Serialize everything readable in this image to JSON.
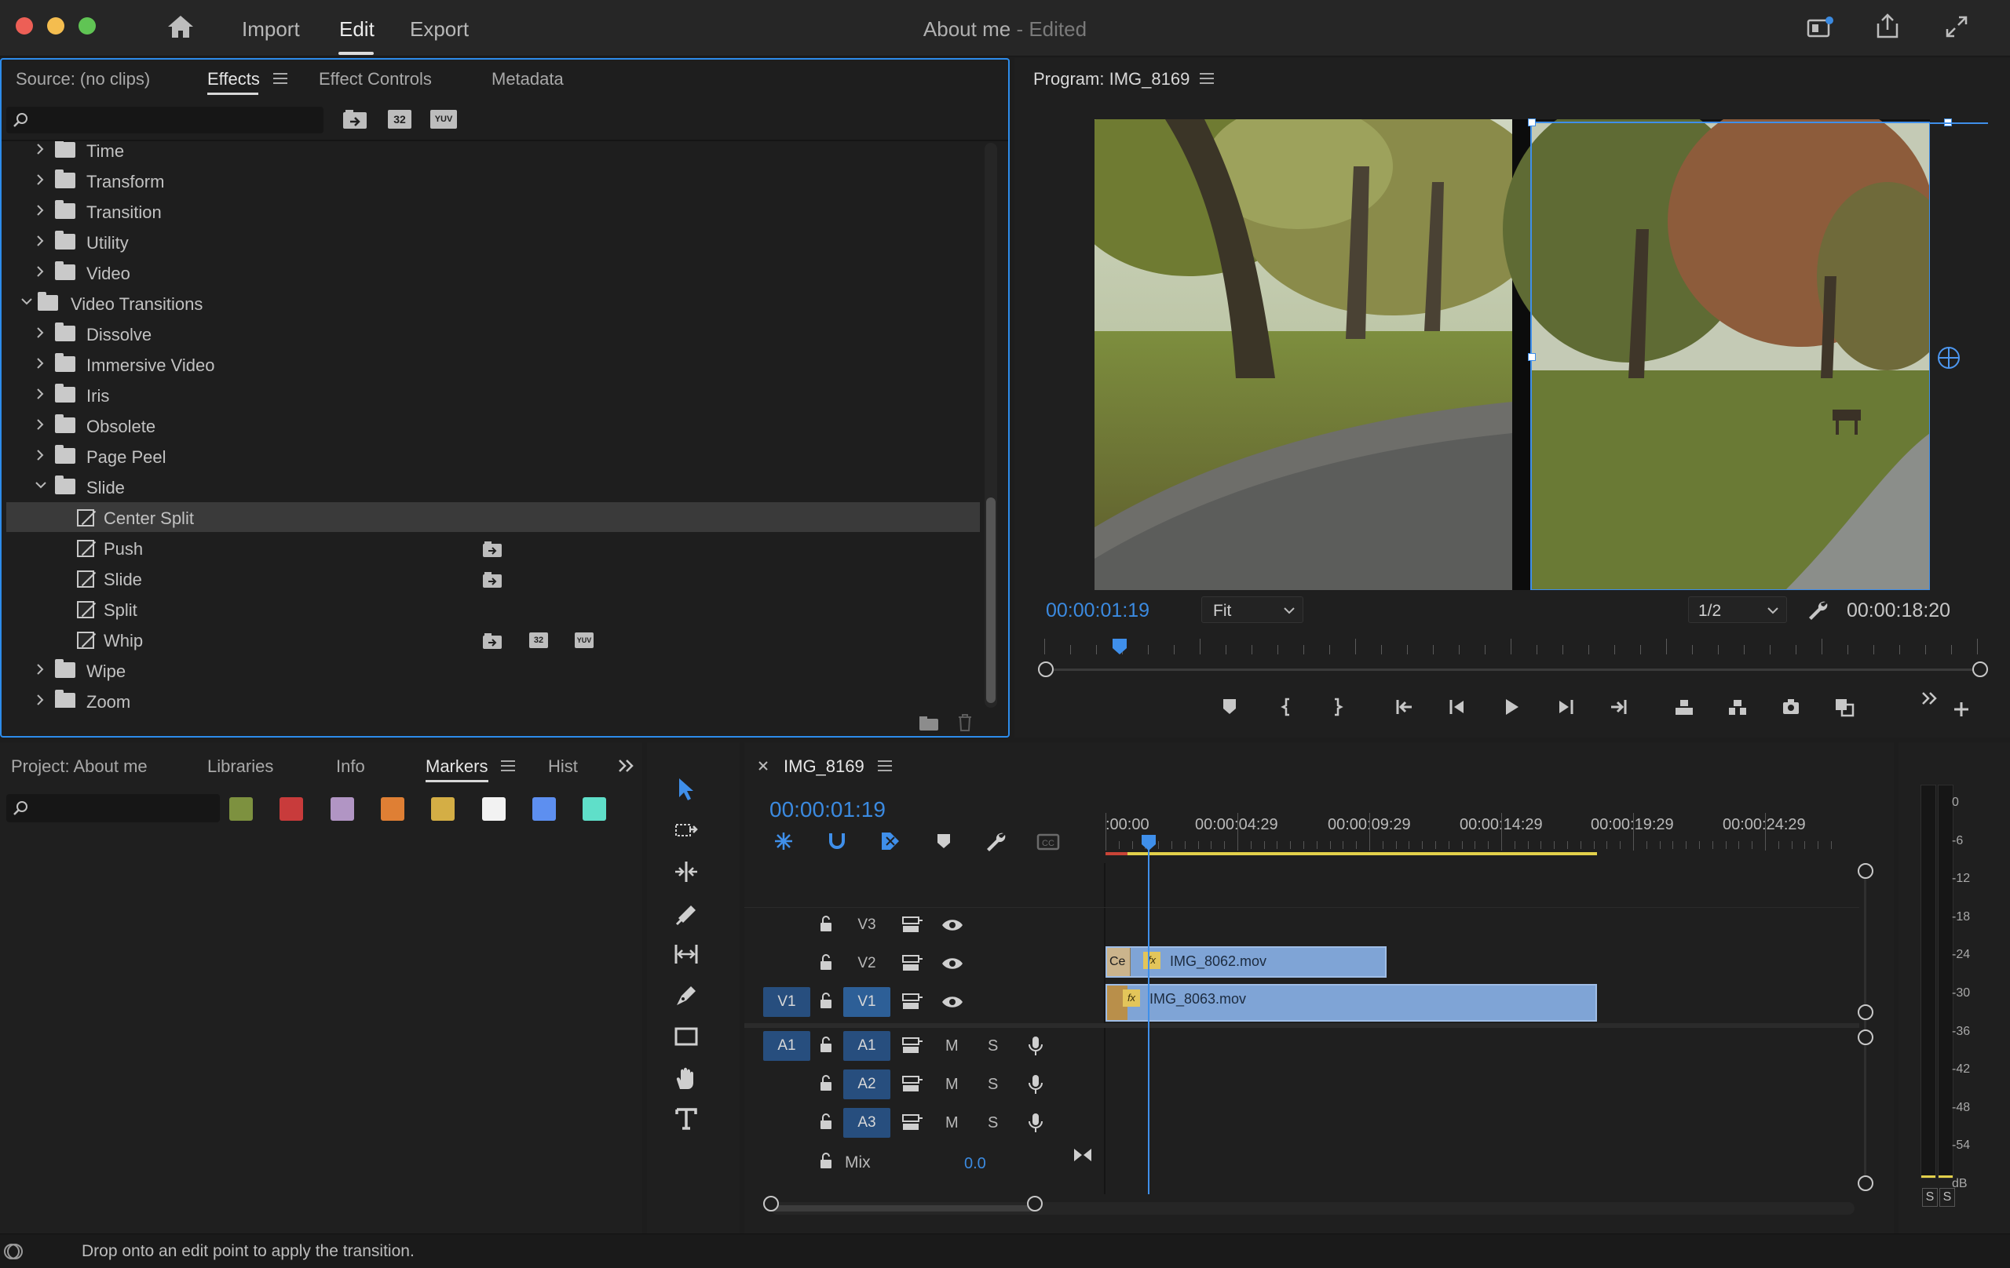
{
  "titlebar": {
    "nav": {
      "import": "Import",
      "edit": "Edit",
      "export": "Export"
    },
    "doc_title": "About me",
    "doc_status": "- Edited"
  },
  "source_panel": {
    "tabs": [
      "Source: (no clips)",
      "Effects",
      "Effect Controls",
      "Metadata"
    ],
    "active_tab": "Effects",
    "search_placeholder": "",
    "filter_badges": [
      "32",
      "YUV"
    ],
    "tree": [
      {
        "label": "Time",
        "kind": "folder",
        "level": 1,
        "expanded": false
      },
      {
        "label": "Transform",
        "kind": "folder",
        "level": 1,
        "expanded": false
      },
      {
        "label": "Transition",
        "kind": "folder",
        "level": 1,
        "expanded": false
      },
      {
        "label": "Utility",
        "kind": "folder",
        "level": 1,
        "expanded": false
      },
      {
        "label": "Video",
        "kind": "folder",
        "level": 1,
        "expanded": false
      },
      {
        "label": "Video Transitions",
        "kind": "folder",
        "level": 0,
        "expanded": true
      },
      {
        "label": "Dissolve",
        "kind": "folder",
        "level": 1,
        "expanded": false
      },
      {
        "label": "Immersive Video",
        "kind": "folder",
        "level": 1,
        "expanded": false
      },
      {
        "label": "Iris",
        "kind": "folder",
        "level": 1,
        "expanded": false
      },
      {
        "label": "Obsolete",
        "kind": "folder",
        "level": 1,
        "expanded": false
      },
      {
        "label": "Page Peel",
        "kind": "folder",
        "level": 1,
        "expanded": false
      },
      {
        "label": "Slide",
        "kind": "folder",
        "level": 1,
        "expanded": true
      },
      {
        "label": "Center Split",
        "kind": "effect",
        "level": 2,
        "selected": true,
        "badges": []
      },
      {
        "label": "Push",
        "kind": "effect",
        "level": 2,
        "badges": [
          "accel"
        ]
      },
      {
        "label": "Slide",
        "kind": "effect",
        "level": 2,
        "badges": [
          "accel"
        ]
      },
      {
        "label": "Split",
        "kind": "effect",
        "level": 2,
        "badges": []
      },
      {
        "label": "Whip",
        "kind": "effect",
        "level": 2,
        "badges": [
          "accel",
          "32",
          "YUV"
        ]
      },
      {
        "label": "Wipe",
        "kind": "folder",
        "level": 1,
        "expanded": false
      },
      {
        "label": "Zoom",
        "kind": "folder",
        "level": 1,
        "expanded": false
      }
    ]
  },
  "program_monitor": {
    "title": "Program: IMG_8169",
    "current_timecode": "00:00:01:19",
    "zoom_select": "Fit",
    "resolution_select": "1/2",
    "duration_timecode": "00:00:18:20",
    "playhead_fraction": 0.08
  },
  "project_panel": {
    "tabs": [
      "Project: About me",
      "Libraries",
      "Info",
      "Markers",
      "Hist"
    ],
    "active_tab": "Markers",
    "search_placeholder": "",
    "marker_colors": [
      "#7d913f",
      "#c83b3b",
      "#b195c4",
      "#df7f34",
      "#d4ae45",
      "#f2f2f2",
      "#5d8ff0",
      "#5fdfc9"
    ]
  },
  "timeline": {
    "sequence_name": "IMG_8169",
    "timecode": "00:00:01:19",
    "ruler": [
      ":00:00",
      "00:00:04:29",
      "00:00:09:29",
      "00:00:14:29",
      "00:00:19:29",
      "00:00:24:29"
    ],
    "video_tracks": [
      {
        "source": "",
        "name": "V3"
      },
      {
        "source": "",
        "name": "V2"
      },
      {
        "source": "V1",
        "name": "V1"
      }
    ],
    "audio_tracks": [
      {
        "source": "A1",
        "name": "A1",
        "mute": "M",
        "solo": "S"
      },
      {
        "source": "",
        "name": "A2",
        "mute": "M",
        "solo": "S"
      },
      {
        "source": "",
        "name": "A3",
        "mute": "M",
        "solo": "S"
      }
    ],
    "mix_label": "Mix",
    "mix_value": "0.0",
    "clips": [
      {
        "name": "IMG_8062.mov",
        "track": "V2",
        "transition_label": "Ce",
        "fx": "fx"
      },
      {
        "name": "IMG_8063.mov",
        "track": "V1",
        "fx": "fx"
      }
    ]
  },
  "audio_meter": {
    "scale": [
      "0",
      "-6",
      "-12",
      "-18",
      "-24",
      "-30",
      "-36",
      "-42",
      "-48",
      "-54",
      "dB"
    ],
    "solo_buttons": [
      "S",
      "S"
    ]
  },
  "status_bar": {
    "message": "Drop onto an edit point to apply the transition."
  },
  "colors": {
    "accent_blue": "#2d8ceb",
    "timecode_blue": "#3b8ae0",
    "track_blue": "#274e7e",
    "clip_blue": "#7fa4d6",
    "fx_yellow": "#e3c55a",
    "work_area_yellow": "#e2d04b"
  }
}
